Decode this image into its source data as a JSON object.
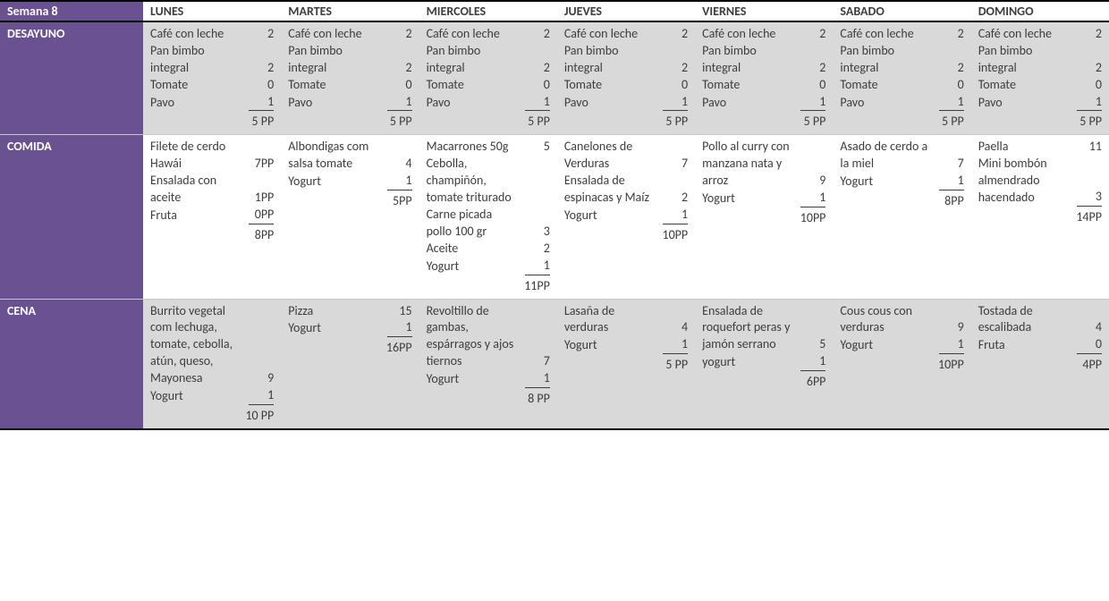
{
  "title": "Semana 8",
  "days": [
    "LUNES",
    "MARTES",
    "MIERCOLES",
    "JUEVES",
    "VIERNES",
    "SABADO",
    "DOMINGO"
  ],
  "meals": [
    {
      "name": "DESAYUNO",
      "alt": false,
      "cells": [
        {
          "items": [
            {
              "name": "Café con leche",
              "val": "2"
            },
            {
              "name": "Pan bimbo integral",
              "val": "2"
            },
            {
              "name": "Tomate",
              "val": "0"
            },
            {
              "name": "Pavo",
              "val": "1"
            }
          ],
          "total": "5 PP"
        },
        {
          "items": [
            {
              "name": "Café con leche",
              "val": "2"
            },
            {
              "name": "Pan bimbo integral",
              "val": "2"
            },
            {
              "name": "Tomate",
              "val": "0"
            },
            {
              "name": "Pavo",
              "val": "1"
            }
          ],
          "total": "5 PP"
        },
        {
          "items": [
            {
              "name": "Café con leche",
              "val": "2"
            },
            {
              "name": "Pan bimbo integral",
              "val": "2"
            },
            {
              "name": "Tomate",
              "val": "0"
            },
            {
              "name": "Pavo",
              "val": "1"
            }
          ],
          "total": "5 PP"
        },
        {
          "items": [
            {
              "name": "Café con leche",
              "val": "2"
            },
            {
              "name": "Pan bimbo integral",
              "val": "2"
            },
            {
              "name": "Tomate",
              "val": "0"
            },
            {
              "name": "Pavo",
              "val": "1"
            }
          ],
          "total": "5 PP"
        },
        {
          "items": [
            {
              "name": "Café con leche",
              "val": "2"
            },
            {
              "name": "Pan bimbo integral",
              "val": "2"
            },
            {
              "name": "Tomate",
              "val": "0"
            },
            {
              "name": "Pavo",
              "val": "1"
            }
          ],
          "total": "5 PP"
        },
        {
          "items": [
            {
              "name": "Café con leche",
              "val": "2"
            },
            {
              "name": "Pan bimbo integral",
              "val": "2"
            },
            {
              "name": "Tomate",
              "val": "0"
            },
            {
              "name": "Pavo",
              "val": "1"
            }
          ],
          "total": "5 PP"
        },
        {
          "items": [
            {
              "name": "Café con leche",
              "val": "2"
            },
            {
              "name": "Pan bimbo integral",
              "val": "2"
            },
            {
              "name": "Tomate",
              "val": "0"
            },
            {
              "name": "Pavo",
              "val": "1"
            }
          ],
          "total": "5 PP"
        }
      ]
    },
    {
      "name": "COMIDA",
      "alt": true,
      "cells": [
        {
          "items": [
            {
              "name": "Filete de cerdo Hawái",
              "val": "7PP"
            },
            {
              "name": "Ensalada con aceite",
              "val": "1PP"
            },
            {
              "name": "Fruta",
              "val": "0PP"
            }
          ],
          "total": "8PP"
        },
        {
          "items": [
            {
              "name": "Albondigas com salsa tomate",
              "val": "4"
            },
            {
              "name": "Yogurt",
              "val": "1"
            }
          ],
          "total": "5PP"
        },
        {
          "items": [
            {
              "name": "Macarrones 50g",
              "val": "5"
            },
            {
              "name": "Cebolla, champiñón, tomate triturado",
              "val": ""
            },
            {
              "name": "Carne picada pollo 100 gr",
              "val": "3"
            },
            {
              "name": "Aceite",
              "val": "2"
            },
            {
              "name": " Yogurt",
              "val": "1"
            }
          ],
          "total": "11PP"
        },
        {
          "items": [
            {
              "name": "Canelones de Verduras",
              "val": "7"
            },
            {
              "name": "Ensalada de espinacas y Maíz",
              "val": "2"
            },
            {
              "name": "Yogurt",
              "val": "1"
            }
          ],
          "total": "10PP"
        },
        {
          "items": [
            {
              "name": "Pollo al curry con manzana nata y arroz",
              "val": "9"
            },
            {
              "name": "Yogurt",
              "val": "1"
            }
          ],
          "total": "10PP"
        },
        {
          "items": [
            {
              "name": "Asado de cerdo a la miel",
              "val": "7"
            },
            {
              "name": "Yogurt",
              "val": "1"
            }
          ],
          "total": "8PP"
        },
        {
          "items": [
            {
              "name": "Paella",
              "val": "11"
            },
            {
              "name": "Mini bombón almendrado hacendado",
              "val": "3"
            }
          ],
          "total": "14PP"
        }
      ]
    },
    {
      "name": "CENA",
      "alt": false,
      "cells": [
        {
          "items": [
            {
              "name": "Burrito vegetal com lechuga, tomate, cebolla, atún, queso, Mayonesa",
              "val": "9"
            },
            {
              "name": "Yogurt",
              "val": "1"
            }
          ],
          "total": "10 PP"
        },
        {
          "items": [
            {
              "name": "Pizza",
              "val": "15"
            },
            {
              "name": "Yogurt",
              "val": "1"
            }
          ],
          "total": "16PP"
        },
        {
          "items": [
            {
              "name": "Revoltillo de gambas, espárragos y ajos tiernos",
              "val": "7"
            },
            {
              "name": "Yogurt",
              "val": "1"
            }
          ],
          "total": "8 PP"
        },
        {
          "items": [
            {
              "name": "Lasaña de verduras",
              "val": "4"
            },
            {
              "name": " Yogurt",
              "val": "1"
            }
          ],
          "total": "5 PP"
        },
        {
          "items": [
            {
              "name": "Ensalada de roquefort peras y jamón serrano",
              "val": "5"
            },
            {
              "name": "yogurt",
              "val": "1"
            }
          ],
          "total": "6PP"
        },
        {
          "items": [
            {
              "name": "Cous cous con verduras",
              "val": "9"
            },
            {
              "name": "Yogurt",
              "val": "1"
            }
          ],
          "total": "10PP"
        },
        {
          "items": [
            {
              "name": "Tostada de escalibada",
              "val": "4"
            },
            {
              "name": "Fruta",
              "val": "0"
            }
          ],
          "total": "4PP"
        }
      ]
    }
  ]
}
